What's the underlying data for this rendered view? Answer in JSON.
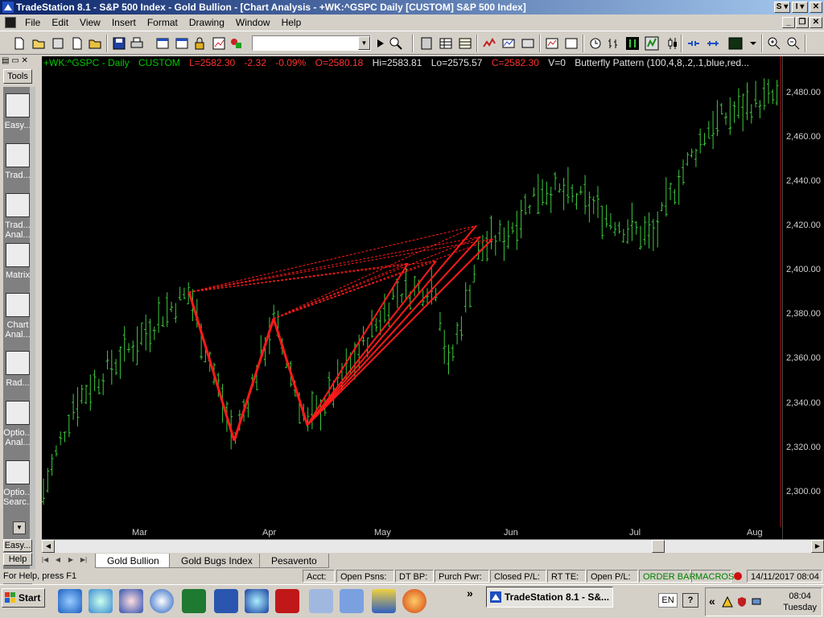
{
  "window": {
    "title": "TradeStation 8.1 - S&P 500 Index - Gold Bullion - [Chart Analysis - +WK:^GSPC  Daily  [CUSTOM] S&P 500 Index]"
  },
  "menu": [
    "File",
    "Edit",
    "View",
    "Insert",
    "Format",
    "Drawing",
    "Window",
    "Help"
  ],
  "tools_panel": {
    "header": "Tools",
    "items": [
      "Easy...",
      "Trad...",
      "Trad...\nAnal...",
      "Matrix",
      "Chart\nAnal...",
      "Rad...",
      "Optio...\nAnal...",
      "Optio...\nSearc..."
    ],
    "easy_label": "Easy...",
    "help_label": "Help"
  },
  "chart": {
    "symbol": "+WK:^GSPC - Daily",
    "session": "CUSTOM",
    "last": "L=2582.30",
    "change": "-2.32",
    "change_pct": "-0.09%",
    "open": "O=2580.18",
    "high": "Hi=2583.81",
    "low": "Lo=2575.57",
    "close": "C=2582.30",
    "volume": "V=0",
    "study": "Butterfly Pattern  (100,4,8,.2,.1,blue,red...",
    "colors": {
      "background": "#000000",
      "bars": "#3cc83c",
      "pattern": "#ff1a1a",
      "header_text": "#00c800",
      "header_red": "#ff3030"
    }
  },
  "price_axis": {
    "labels": [
      "2,480.00",
      "2,460.00",
      "2,440.00",
      "2,420.00",
      "2,400.00",
      "2,380.00",
      "2,360.00",
      "2,340.00",
      "2,320.00",
      "2,300.00"
    ]
  },
  "date_axis": {
    "labels": [
      "Mar",
      "Apr",
      "May",
      "Jun",
      "Jul",
      "Aug"
    ]
  },
  "tabs": [
    "Gold Bullion",
    "Gold Bugs Index",
    "Pesavento"
  ],
  "status": {
    "help": "For Help, press F1",
    "acct": "Acct:",
    "open_psns": "Open Psns:",
    "dt_bp": "DT BP:",
    "purch_pwr": "Purch Pwr:",
    "closed_pl": "Closed P/L:",
    "rt_te": "RT TE:",
    "open_pl": "Open P/L:",
    "order_bar": "ORDER BAR",
    "macros": "MACROS",
    "datetime": "14/11/2017 08:04"
  },
  "taskbar": {
    "start": "Start",
    "task": "TradeStation 8.1 - S&...",
    "lang": "EN",
    "time": "08:04",
    "day": "Tuesday"
  }
}
